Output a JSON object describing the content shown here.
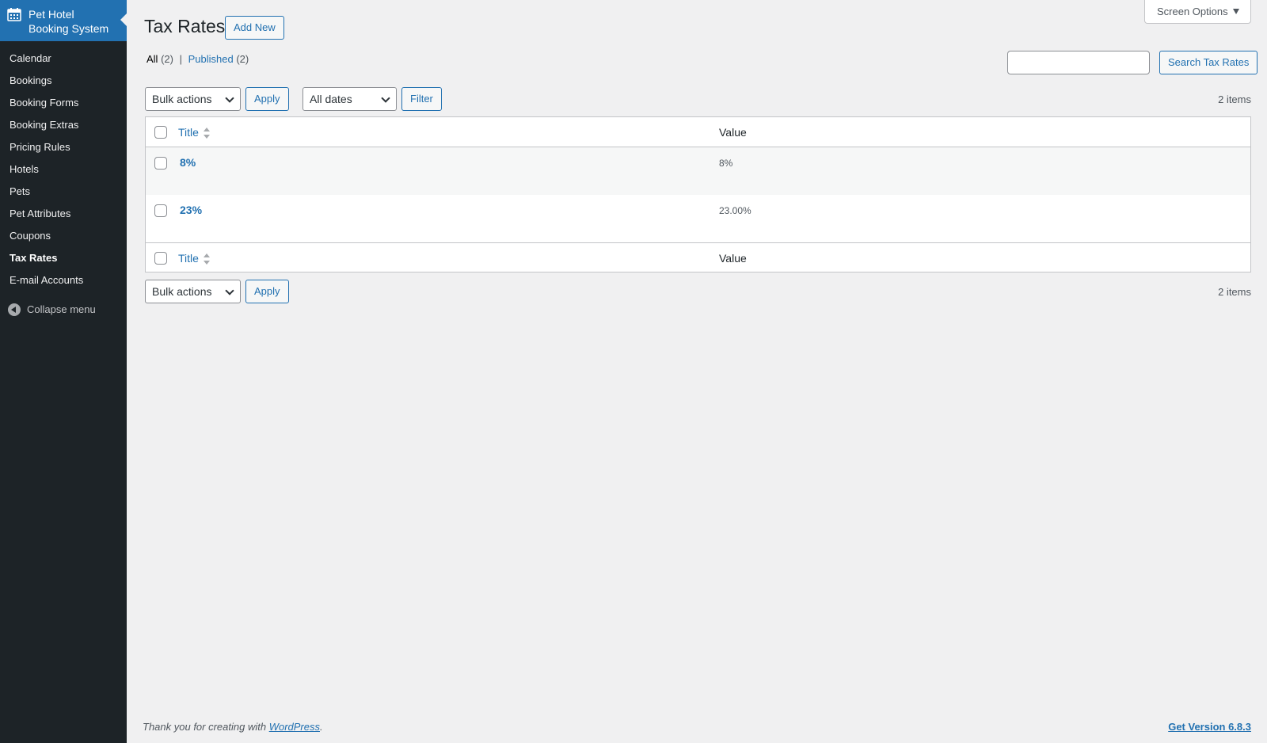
{
  "sidebar": {
    "brand_line1": "Pet Hotel",
    "brand_line2": "Booking System",
    "items": [
      {
        "label": "Calendar"
      },
      {
        "label": "Bookings"
      },
      {
        "label": "Booking Forms"
      },
      {
        "label": "Booking Extras"
      },
      {
        "label": "Pricing Rules"
      },
      {
        "label": "Hotels"
      },
      {
        "label": "Pets"
      },
      {
        "label": "Pet Attributes"
      },
      {
        "label": "Coupons"
      },
      {
        "label": "Tax Rates"
      },
      {
        "label": "E-mail Accounts"
      }
    ],
    "current": "Tax Rates",
    "collapse_label": "Collapse menu"
  },
  "header": {
    "title": "Tax Rates",
    "add_new_label": "Add New",
    "screen_options_label": "Screen Options"
  },
  "views": {
    "all_label": "All",
    "all_count": "(2)",
    "separator": "|",
    "published_label": "Published",
    "published_count": "(2)"
  },
  "search": {
    "value": "",
    "button_label": "Search Tax Rates"
  },
  "tablenav_top": {
    "bulk_actions": "Bulk actions",
    "apply_label": "Apply",
    "dates": "All dates",
    "filter_label": "Filter",
    "count": "2 items"
  },
  "table": {
    "columns": [
      "Title",
      "Value"
    ],
    "rows": [
      {
        "title": "8%",
        "value": "8%"
      },
      {
        "title": "23%",
        "value": "23.00%"
      }
    ]
  },
  "tablenav_bottom": {
    "bulk_actions": "Bulk actions",
    "apply_label": "Apply",
    "count": "2 items"
  },
  "footer": {
    "thanks_prefix": "Thank you for creating with ",
    "wordpress_link": "WordPress",
    "thanks_suffix": ".",
    "version_label": "Get Version 6.8.3"
  },
  "colors": {
    "sidebar_bg": "#1d2327",
    "accent": "#2271b1",
    "page_bg": "#f0f0f1"
  }
}
